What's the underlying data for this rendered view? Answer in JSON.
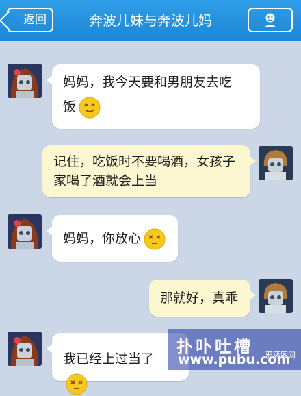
{
  "header": {
    "back_label": "返回",
    "title": "奔波儿妹与奔波儿妈",
    "profile_icon": "person-icon"
  },
  "messages": [
    {
      "side": "left",
      "sender": "daughter",
      "text_line1": "妈妈，我今天要和男朋友去吃",
      "text_line2": "饭",
      "emoji": "smile-emoji"
    },
    {
      "side": "right",
      "sender": "mother",
      "text_line1": "记住，吃饭时不要喝酒，女孩子",
      "text_line2": "家喝了酒就会上当"
    },
    {
      "side": "left",
      "sender": "daughter",
      "text_line1": "妈妈，你放心",
      "emoji": "dizzy-emoji"
    },
    {
      "side": "right",
      "sender": "mother",
      "text_line1": "那就好，真乖"
    },
    {
      "side": "left",
      "sender": "daughter",
      "text_line1": "我已经上过当了",
      "emoji": "dizzy-emoji"
    }
  ],
  "watermark": {
    "main": "扑卟吐槽",
    "url": "www.pubu.com",
    "small": "邪恶图网"
  },
  "colors": {
    "header": "#1f8ad9",
    "background": "#cbd7e6",
    "bubble_left": "#ffffff",
    "bubble_right": "#fcf7d0"
  }
}
